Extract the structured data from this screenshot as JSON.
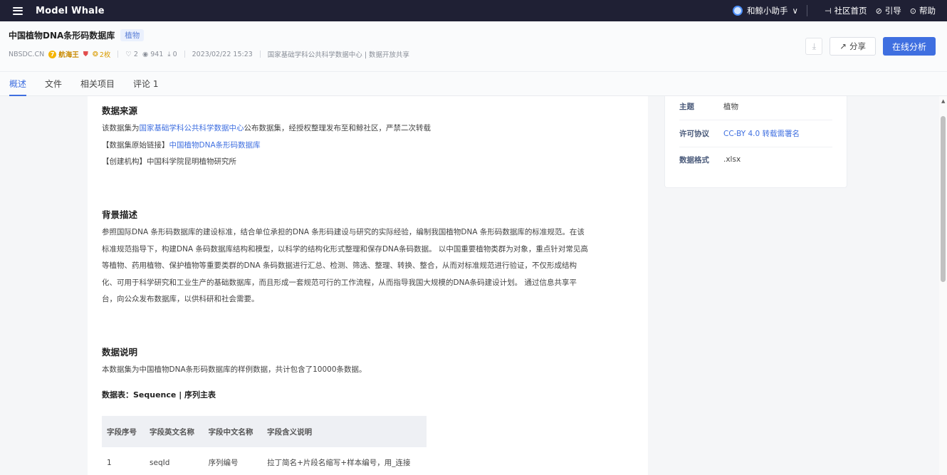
{
  "app": {
    "brand": "Model Whale"
  },
  "topbar": {
    "assistant_label": "和鲸小助手",
    "assistant_chevron": "∨",
    "links": [
      {
        "icon": "community-icon",
        "glyph": "⊣",
        "label": "社区首页"
      },
      {
        "icon": "guide-icon",
        "glyph": "⊘",
        "label": "引导"
      },
      {
        "icon": "help-icon",
        "glyph": "⊙",
        "label": "帮助"
      }
    ]
  },
  "dataset": {
    "title": "中国植物DNA条形码数据库",
    "tag": "植物",
    "owner": "NBSDC.CN",
    "level_label": "航海王",
    "level_glyph": "7",
    "medal_count": "2枚",
    "likes": "2",
    "views": "941",
    "downloads": "0",
    "datetime": "2023/02/22 15:23",
    "source_note": "国家基础学科公共科学数据中心 | 数据开放共享"
  },
  "actions": {
    "share_label": "分享",
    "analyze_label": "在线分析"
  },
  "tabs": [
    "概述",
    "文件",
    "相关项目",
    "评论 1"
  ],
  "sections": {
    "source": {
      "title": "数据来源",
      "line1_prefix": "该数据集为",
      "line1_link": "国家基础学科公共科学数据中心",
      "line1_suffix": "公布数据集，经授权整理发布至和鲸社区，严禁二次转载",
      "line2_prefix": "【数据集原始链接】",
      "line2_link": "中国植物DNA条形码数据库",
      "line3": "【创建机构】中国科学院昆明植物研究所"
    },
    "background": {
      "title": "背景描述",
      "lines": [
        "参照国际DNA 条形码数据库的建设标准，结合单位承担的DNA 条形码建设与研究的实际经验，编制我国植物DNA 条形码数据库的标准规范。在该",
        "标准规范指导下，构建DNA 条码数据库结构和模型，以科学的结构化形式整理和保存DNA条码数据。 以中国重要植物类群为对象，重点针对常见高",
        "等植物、药用植物、保护植物等重要类群的DNA 条码数据进行汇总、检测、筛选、整理、转换、整合，从而对标准规范进行验证，不仅形成结构",
        "化、可用于科学研究和工业生产的基础数据库，而且形成一套规范可行的工作流程，从而指导我国大规模的DNA条码建设计划。 通过信息共享平",
        "台，向公众发布数据库，以供科研和社会需要。"
      ]
    },
    "description": {
      "title": "数据说明",
      "text": "本数据集为中国植物DNA条形码数据库的样例数据，共计包含了10000条数据。",
      "table_title": "数据表：Sequence | 序列主表",
      "columns": [
        "字段序号",
        "字段英文名称",
        "字段中文名称",
        "字段含义说明"
      ],
      "rows": [
        [
          "1",
          "seqId",
          "序列编号",
          "拉丁简名+片段名缩写+样本编号，用_连接"
        ]
      ]
    }
  },
  "info": [
    {
      "key": "主题",
      "value": "植物",
      "link": false
    },
    {
      "key": "许可协议",
      "value": "CC-BY 4.0 转载需署名",
      "link": true
    },
    {
      "key": "数据格式",
      "value": ".xlsx",
      "link": false
    }
  ]
}
